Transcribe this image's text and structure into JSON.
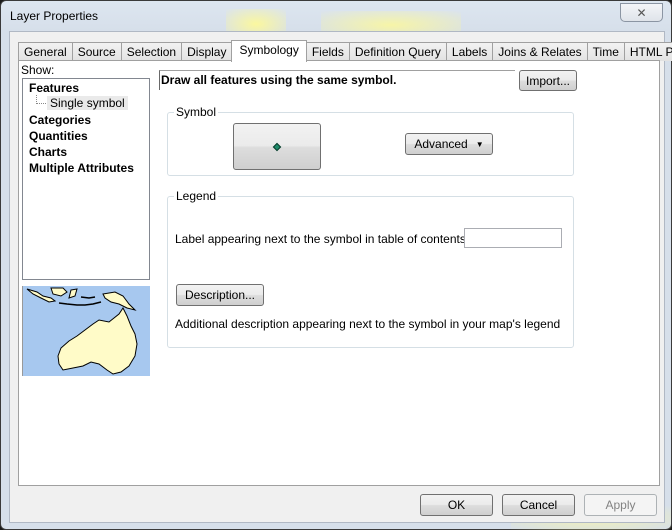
{
  "window": {
    "title": "Layer Properties",
    "close_icon": "close-x-icon"
  },
  "tabs": [
    {
      "label": "General",
      "active": false
    },
    {
      "label": "Source",
      "active": false
    },
    {
      "label": "Selection",
      "active": false
    },
    {
      "label": "Display",
      "active": false
    },
    {
      "label": "Symbology",
      "active": true
    },
    {
      "label": "Fields",
      "active": false
    },
    {
      "label": "Definition Query",
      "active": false
    },
    {
      "label": "Labels",
      "active": false
    },
    {
      "label": "Joins & Relates",
      "active": false
    },
    {
      "label": "Time",
      "active": false
    },
    {
      "label": "HTML Popup",
      "active": false
    }
  ],
  "show": {
    "label": "Show:",
    "tree": {
      "features": "Features",
      "single_symbol": "Single symbol",
      "categories": "Categories",
      "quantities": "Quantities",
      "charts": "Charts",
      "multiple_attributes": "Multiple Attributes"
    },
    "thumbnail": "australia-map-preview"
  },
  "symbology": {
    "description": "Draw all features using the same symbol.",
    "import_label": "Import...",
    "symbol_group": "Symbol",
    "symbol_color": "#1e8a6a",
    "advanced_label": "Advanced",
    "legend_group": "Legend",
    "label_prompt": "Label appearing next to the symbol in table of contents:",
    "label_value": "",
    "description_button": "Description...",
    "description_hint": "Additional description appearing next to the symbol in your map's legend"
  },
  "footer": {
    "ok": "OK",
    "cancel": "Cancel",
    "apply": "Apply"
  }
}
